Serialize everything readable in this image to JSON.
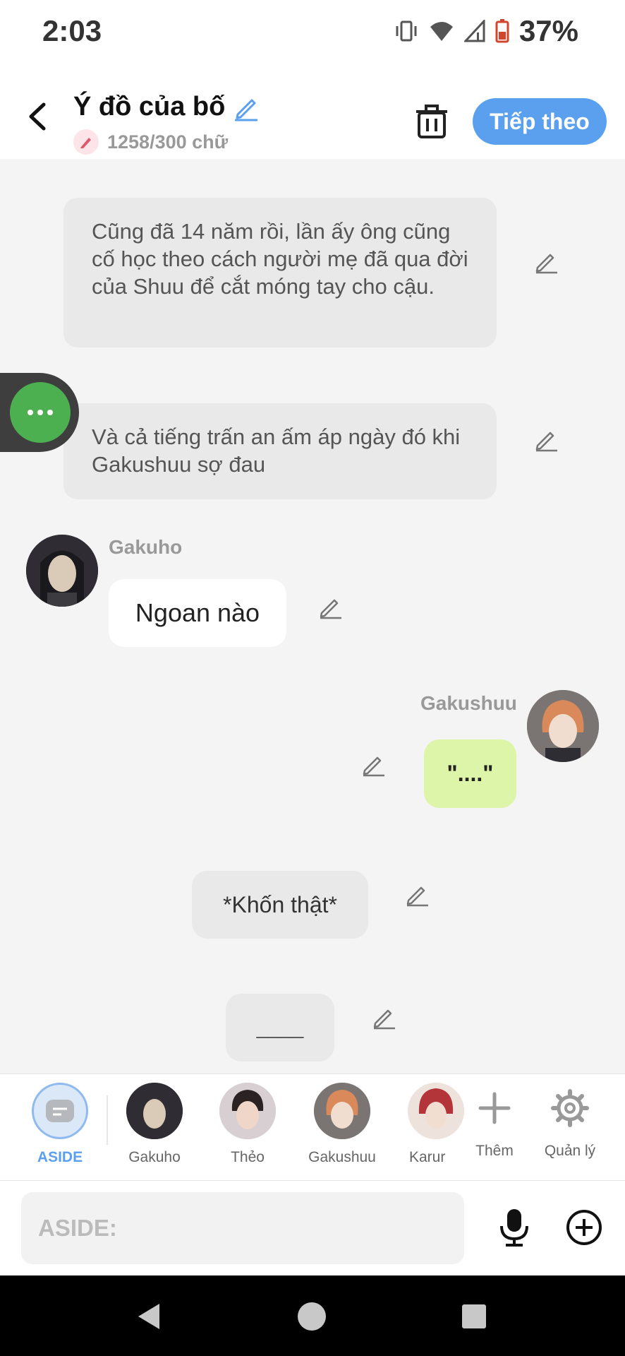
{
  "status": {
    "time": "2:03",
    "battery": "37%"
  },
  "header": {
    "title": "Ý đồ của bố",
    "word_count": "1258/300 chữ",
    "next_label": "Tiếp theo"
  },
  "messages": {
    "narr1": "Cũng đã 14 năm rồi, lần ấy ông cũng cố học theo cách người mẹ đã qua đời của Shuu để cắt móng tay cho cậu.",
    "narr2": "Và cả tiếng trấn an ấm áp ngày đó khi Gakushuu sợ đau",
    "gakuho_name": "Gakuho",
    "gakuho_text": "Ngoan nào",
    "gakushuu_name": "Gakushuu",
    "gakushuu_text": "\"....\"",
    "narr3": "*Khốn thật*",
    "narr4": "____"
  },
  "charbar": {
    "items": [
      "ASIDE",
      "Gakuho",
      "Thẻo",
      "Gakushuu",
      "Karur"
    ],
    "add_label": "Thêm",
    "manage_label": "Quản lý"
  },
  "input": {
    "placeholder": "ASIDE:"
  },
  "colors": {
    "accent": "#5aa0ee",
    "green": "#4caf50",
    "user_bubble": "#dcf5a8"
  }
}
